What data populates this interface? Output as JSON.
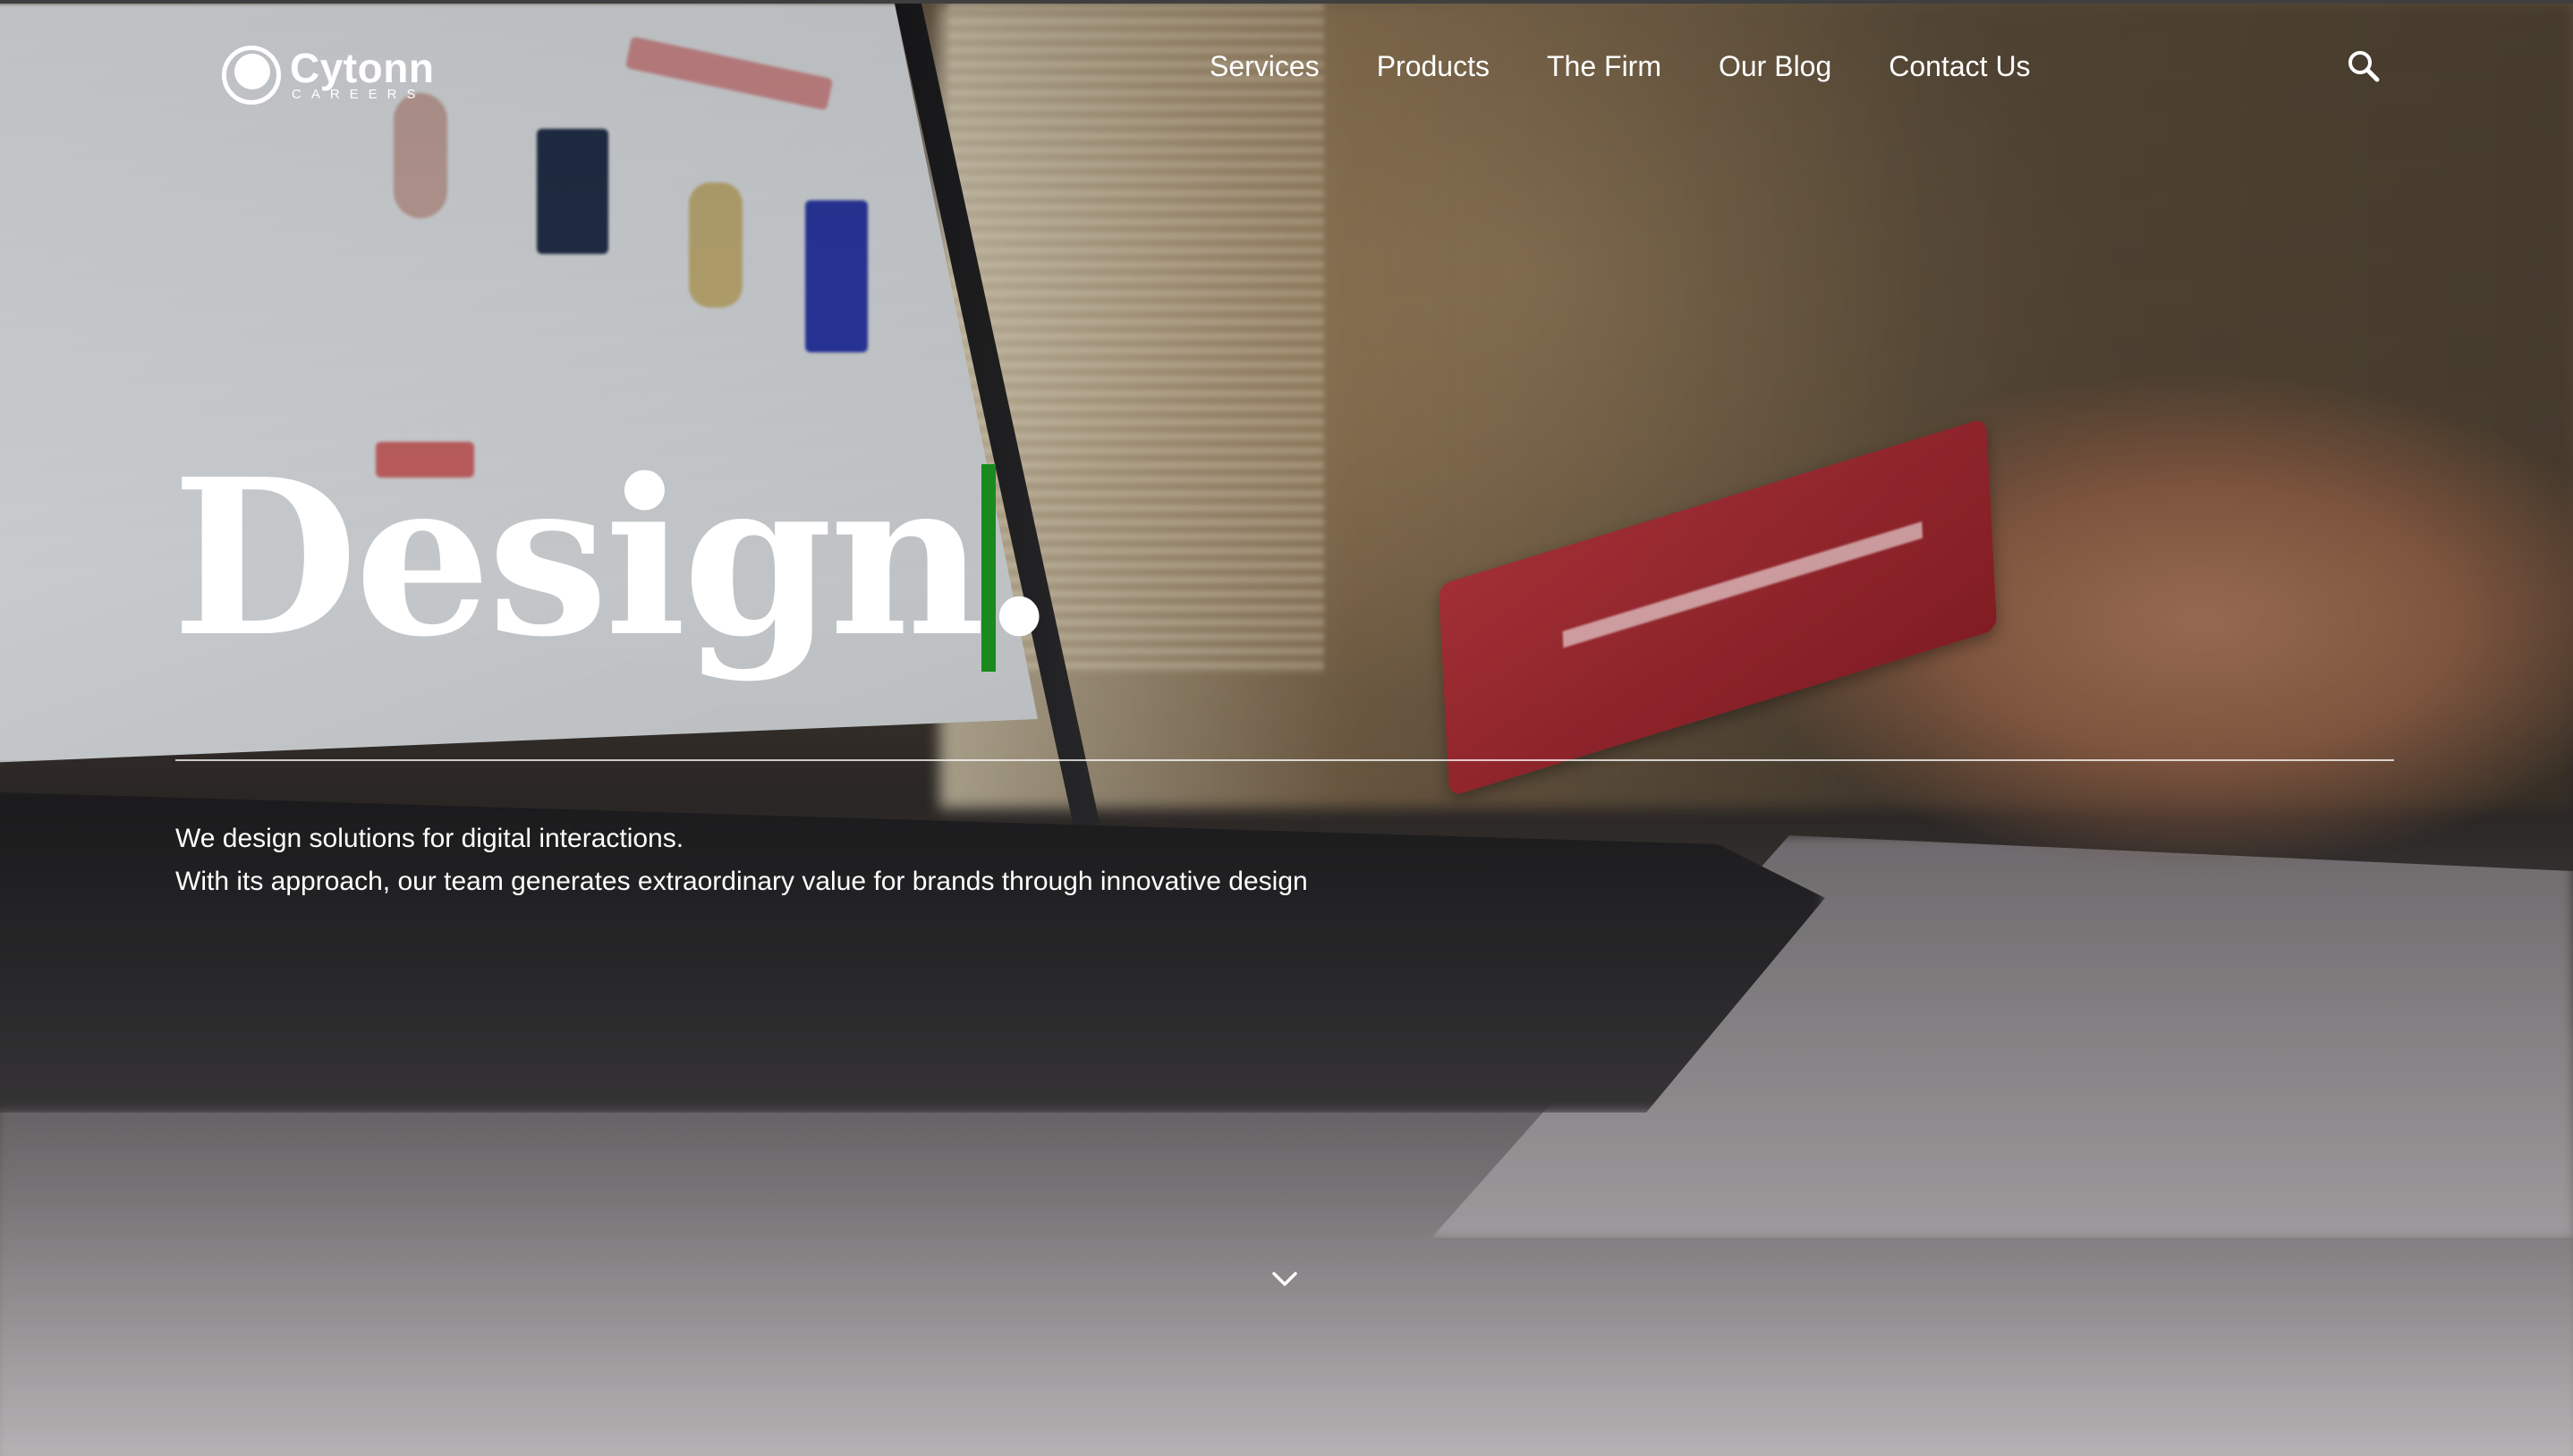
{
  "brand": {
    "name": "Cytonn",
    "sub": "CAREERS"
  },
  "nav": {
    "items": [
      {
        "label": "Services"
      },
      {
        "label": "Products"
      },
      {
        "label": "The Firm"
      },
      {
        "label": "Our Blog"
      },
      {
        "label": "Contact Us"
      }
    ]
  },
  "hero": {
    "headline": "Design.",
    "tagline_line1": "We design solutions for digital interactions.",
    "tagline_line2": "With its approach, our team generates extraordinary value for brands through innovative design"
  },
  "icons": {
    "search": "search-icon",
    "scroll": "chevron-down-icon"
  },
  "colors": {
    "accent": "#1a8a1f",
    "text": "#ffffff"
  }
}
